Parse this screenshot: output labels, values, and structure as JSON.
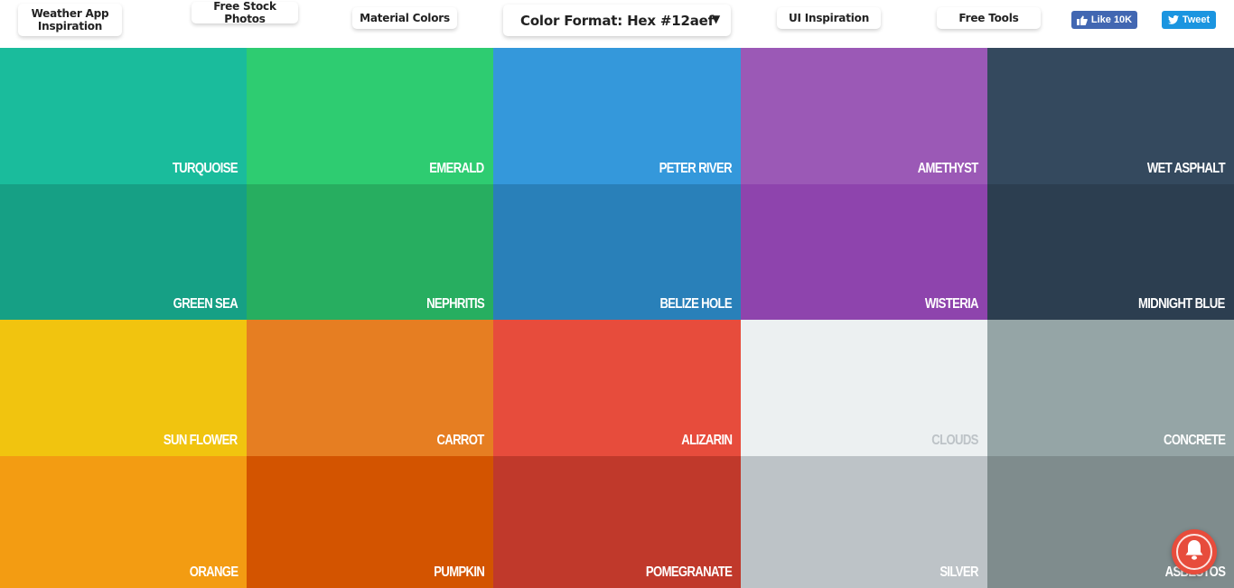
{
  "header": {
    "nav": {
      "weather": "Weather App Inspiration",
      "stock": "Free Stock Photos",
      "material": "Material Colors",
      "ui": "UI Inspiration",
      "tools": "Free Tools"
    },
    "format_select": {
      "label": "Color Format: Hex #12aef",
      "caret": "▼"
    },
    "social": {
      "like_label": "Like 10K",
      "tweet_label": "Tweet",
      "like_color": "#4267b2",
      "tweet_color": "#1b95e0"
    }
  },
  "palette": [
    {
      "name": "TURQUOISE",
      "color": "#1abc9c",
      "label_color": "#ffffff"
    },
    {
      "name": "EMERALD",
      "color": "#2ecc71",
      "label_color": "#ffffff"
    },
    {
      "name": "PETER RIVER",
      "color": "#3498db",
      "label_color": "#ffffff"
    },
    {
      "name": "AMETHYST",
      "color": "#9b59b6",
      "label_color": "#ffffff"
    },
    {
      "name": "WET ASPHALT",
      "color": "#34495e",
      "label_color": "#ffffff"
    },
    {
      "name": "GREEN SEA",
      "color": "#16a085",
      "label_color": "#ffffff"
    },
    {
      "name": "NEPHRITIS",
      "color": "#27ae60",
      "label_color": "#ffffff"
    },
    {
      "name": "BELIZE HOLE",
      "color": "#2980b9",
      "label_color": "#ffffff"
    },
    {
      "name": "WISTERIA",
      "color": "#8e44ad",
      "label_color": "#ffffff"
    },
    {
      "name": "MIDNIGHT BLUE",
      "color": "#2c3e50",
      "label_color": "#ffffff"
    },
    {
      "name": "SUN FLOWER",
      "color": "#f1c40f",
      "label_color": "#ffffff"
    },
    {
      "name": "CARROT",
      "color": "#e67e22",
      "label_color": "#ffffff"
    },
    {
      "name": "ALIZARIN",
      "color": "#e74c3c",
      "label_color": "#ffffff"
    },
    {
      "name": "CLOUDS",
      "color": "#ecf0f1",
      "label_color": "#bdc3c7"
    },
    {
      "name": "CONCRETE",
      "color": "#95a5a6",
      "label_color": "#ffffff"
    },
    {
      "name": "ORANGE",
      "color": "#f39c12",
      "label_color": "#ffffff"
    },
    {
      "name": "PUMPKIN",
      "color": "#d35400",
      "label_color": "#ffffff"
    },
    {
      "name": "POMEGRANATE",
      "color": "#c0392b",
      "label_color": "#ffffff"
    },
    {
      "name": "SILVER",
      "color": "#bdc3c7",
      "label_color": "#ffffff"
    },
    {
      "name": "ASBESTOS",
      "color": "#7f8c8d",
      "label_color": "#ffffff"
    }
  ],
  "notification": {
    "icon": "bell-icon",
    "color": "#e74c3c"
  }
}
